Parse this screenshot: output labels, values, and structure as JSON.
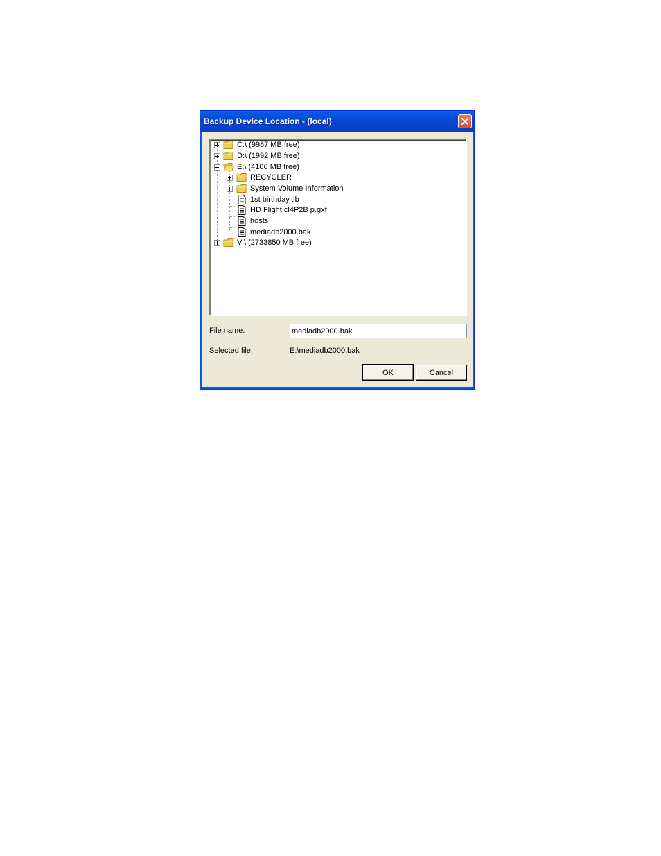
{
  "dialog": {
    "title": "Backup Device Location - (local)",
    "close_icon": "close-icon"
  },
  "tree": {
    "drives": [
      {
        "label": "C:\\ (9987 MB free)",
        "expanded": false
      },
      {
        "label": "D:\\ (1992 MB free)",
        "expanded": false
      },
      {
        "label": "E:\\ (4106 MB free)",
        "expanded": true
      },
      {
        "label": "V:\\ (2733850 MB free)",
        "expanded": false
      }
    ],
    "e_children": [
      {
        "label": "RECYCLER",
        "kind": "folder"
      },
      {
        "label": "System Volume Information",
        "kind": "folder"
      },
      {
        "label": "1st birthday.tlb",
        "kind": "file"
      },
      {
        "label": "HD Flight cl4P2B p.gxf",
        "kind": "file"
      },
      {
        "label": "hosts",
        "kind": "file"
      },
      {
        "label": "mediadb2000.bak",
        "kind": "file"
      }
    ]
  },
  "form": {
    "file_name_label": "File name:",
    "file_name_value": "mediadb2000.bak",
    "selected_file_label": "Selected file:",
    "selected_file_value": "E:\\mediadb2000.bak"
  },
  "buttons": {
    "ok": "OK",
    "cancel": "Cancel"
  },
  "colors": {
    "titlebar": "#0a5ce8",
    "dialog_bg": "#ece9d8",
    "folder": "#f2cf52",
    "close": "#d3502e"
  }
}
